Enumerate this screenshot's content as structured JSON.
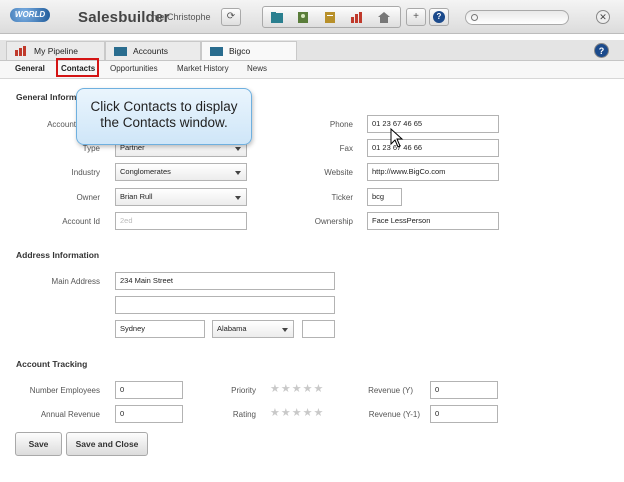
{
  "header": {
    "logo_text": "whirl the WORLD",
    "app_title": "Salesbuilder",
    "user_name_fragment": "me Christophe",
    "refresh_icon": "refresh-icon",
    "toolbar_icons": [
      "accounts-icon",
      "contacts-icon",
      "documents-icon",
      "pipeline-icon",
      "home-icon"
    ],
    "add_label": "+",
    "help_label": "?",
    "close_label": "✕"
  },
  "main_tabs": [
    {
      "label": "My Pipeline",
      "icon": "pipeline-icon"
    },
    {
      "label": "Accounts",
      "icon": "folder-icon"
    },
    {
      "label": "Bigco",
      "icon": "folder-icon"
    }
  ],
  "main_help_label": "?",
  "sub_tabs": [
    "General",
    "Contacts",
    "Opportunities",
    "Market History",
    "News"
  ],
  "callout": {
    "line1": "Click Contacts to display",
    "line2": "the Contacts window."
  },
  "general": {
    "section_title": "General Information",
    "account_label": "Account",
    "type_label": "Type",
    "type_value": "Partner",
    "industry_label": "Industry",
    "industry_value": "Conglomerates",
    "owner_label": "Owner",
    "owner_value": "Brian Rull",
    "account_id_label": "Account Id",
    "account_id_value": "2ed",
    "phone_label": "Phone",
    "phone_value": "01 23 67 46 65",
    "fax_label": "Fax",
    "fax_value": "01 23 67 46 66",
    "website_label": "Website",
    "website_value": "http://www.BigCo.com",
    "ticker_label": "Ticker",
    "ticker_value": "bcg",
    "ownership_label": "Ownership",
    "ownership_value": "Face LessPerson"
  },
  "address": {
    "section_title": "Address Information",
    "main_address_label": "Main Address",
    "line1": "234 Main Street",
    "line2": "",
    "city": "Sydney",
    "state": "Alabama",
    "zip": ""
  },
  "tracking": {
    "section_title": "Account Tracking",
    "employees_label": "Number Employees",
    "employees_value": "0",
    "annual_revenue_label": "Annual Revenue",
    "annual_revenue_value": "0",
    "priority_label": "Priority",
    "priority_stars": 0,
    "rating_label": "Rating",
    "rating_stars": 0,
    "revenue_y_label": "Revenue (Y)",
    "revenue_y_value": "0",
    "revenue_y1_label": "Revenue (Y-1)",
    "revenue_y1_value": "0"
  },
  "buttons": {
    "save": "Save",
    "save_close": "Save and Close"
  }
}
